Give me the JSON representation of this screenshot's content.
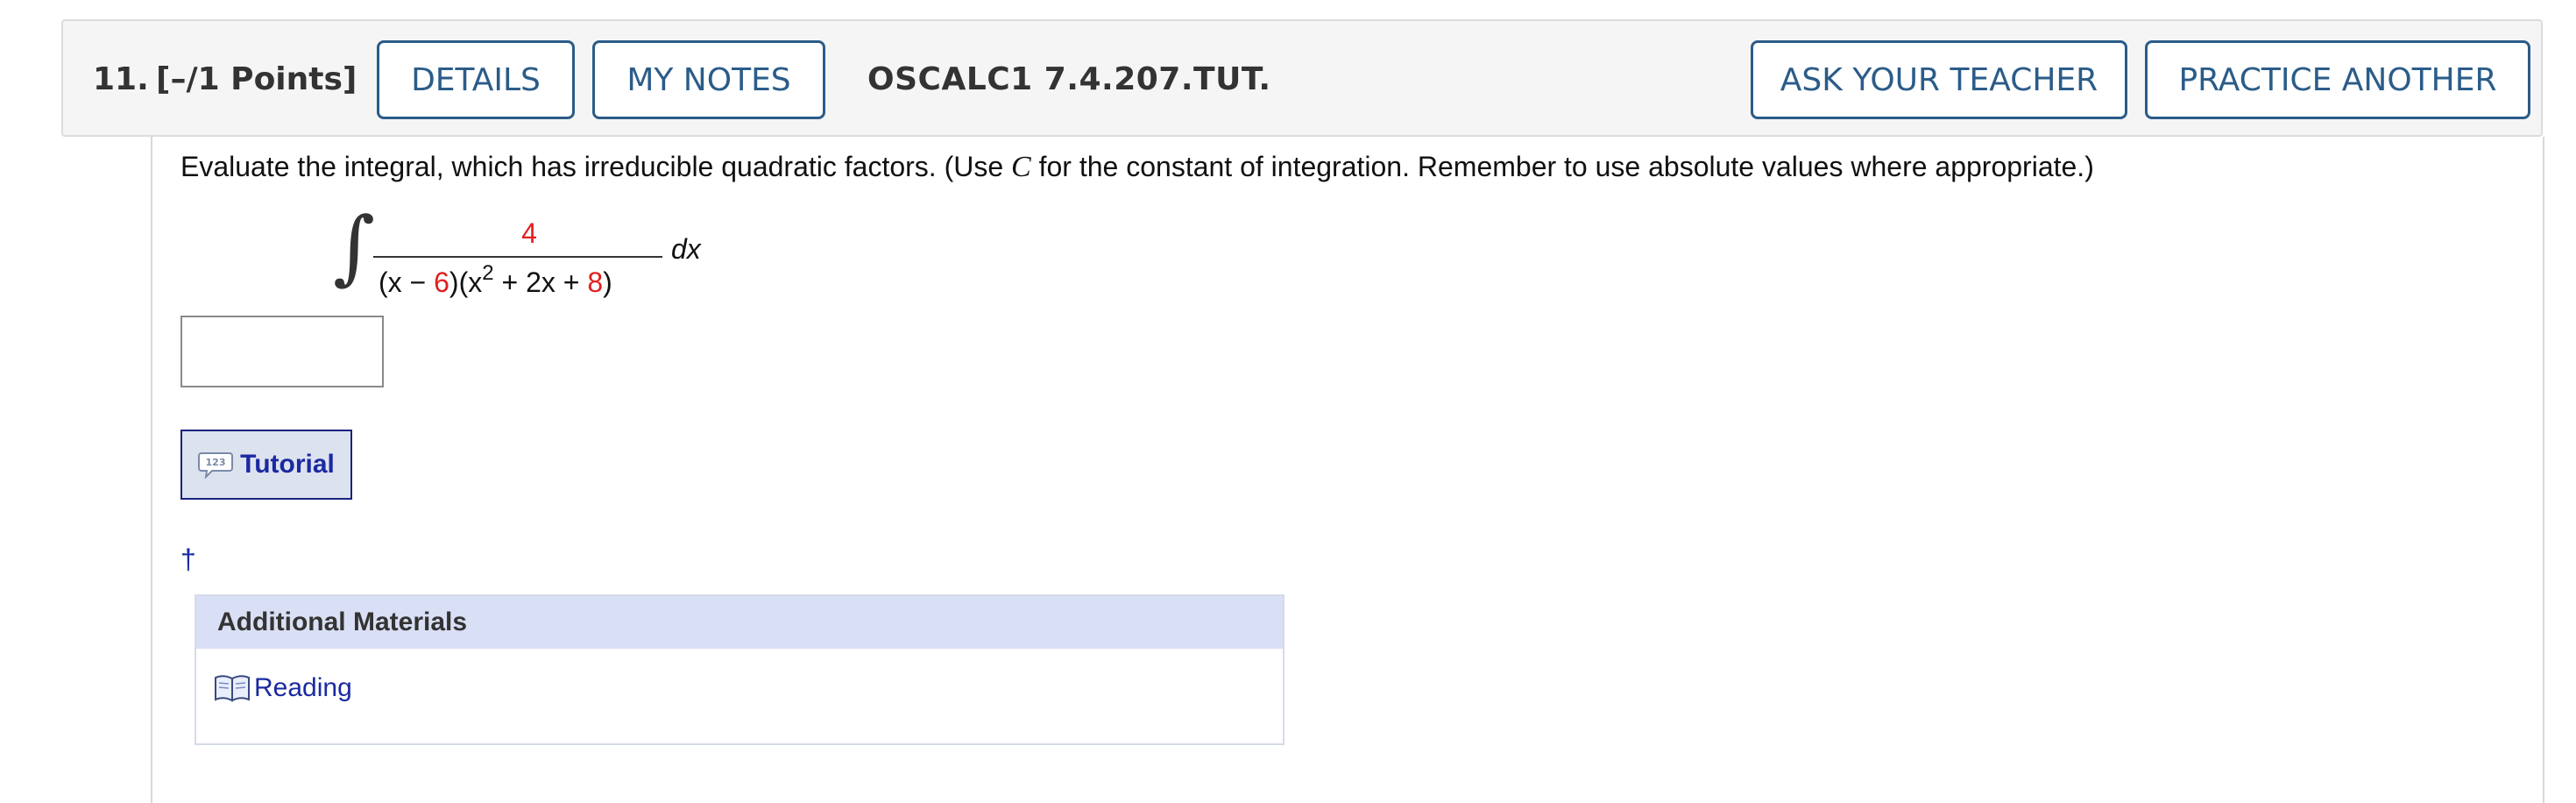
{
  "question": {
    "number": "11.",
    "points": "[–/1 Points]",
    "code": "OSCALC1 7.4.207.TUT."
  },
  "header_buttons": {
    "details": "DETAILS",
    "my_notes": "MY NOTES",
    "ask_teacher": "ASK YOUR TEACHER",
    "practice_another": "PRACTICE ANOTHER"
  },
  "prompt": {
    "part1": "Evaluate the integral, which has irreducible quadratic factors. (Use ",
    "var": "C",
    "part2": " for the constant of integration. Remember to use absolute values where appropriate.)"
  },
  "integral": {
    "sign": "∫",
    "numerator": "4",
    "denom_open": "(x − ",
    "denom_a": "6",
    "denom_mid": ")(x",
    "denom_exp": "2",
    "denom_plus": " + 2x + ",
    "denom_b": "8",
    "denom_close": ")",
    "differential": "dx"
  },
  "answer": {
    "value": ""
  },
  "tutorial": {
    "label": "Tutorial",
    "icon": "tutorial-123-icon"
  },
  "dagger": "†",
  "additional_materials": {
    "heading": "Additional Materials",
    "items": [
      {
        "label": "Reading",
        "icon": "book-icon"
      }
    ]
  },
  "colors": {
    "button_border": "#2b5c89",
    "highlight_red": "#e02020",
    "link_blue": "#1a2aa0",
    "materials_header": "#d9dff4"
  }
}
